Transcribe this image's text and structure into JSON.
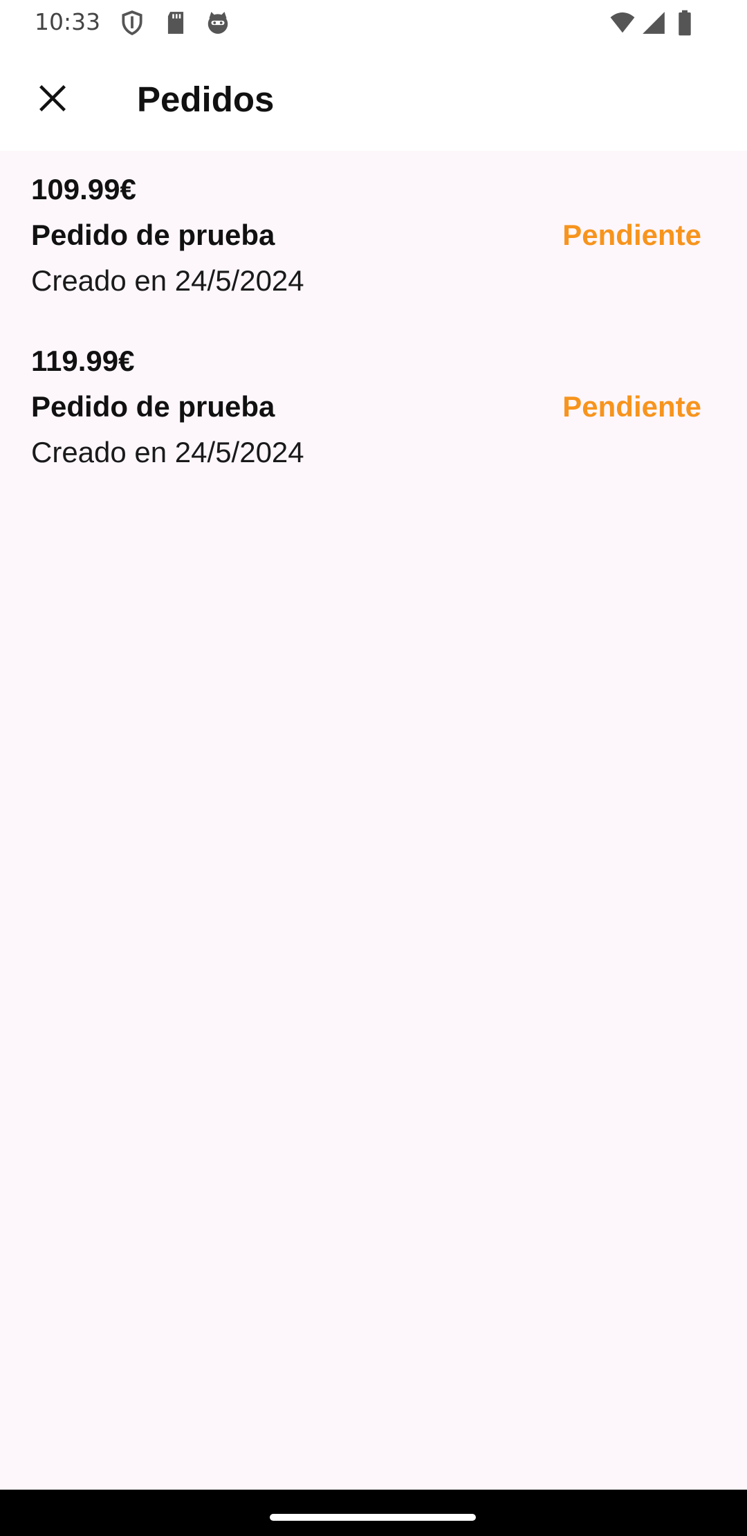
{
  "status_bar": {
    "time": "10:33",
    "left_icons": [
      "shield-icon",
      "sd-card-icon",
      "cat-icon"
    ],
    "right_icons": [
      "wifi-icon",
      "signal-icon",
      "battery-icon"
    ]
  },
  "app_bar": {
    "close_icon": "close-icon",
    "title": "Pedidos"
  },
  "orders": [
    {
      "price": "109.99€",
      "name": "Pedido de prueba",
      "date": "Creado en 24/5/2024",
      "status": "Pendiente"
    },
    {
      "price": "119.99€",
      "name": "Pedido de prueba",
      "date": "Creado en 24/5/2024",
      "status": "Pendiente"
    }
  ],
  "colors": {
    "status_pending": "#f7941d",
    "background": "#fdf7fc",
    "app_bar": "#ffffff"
  }
}
